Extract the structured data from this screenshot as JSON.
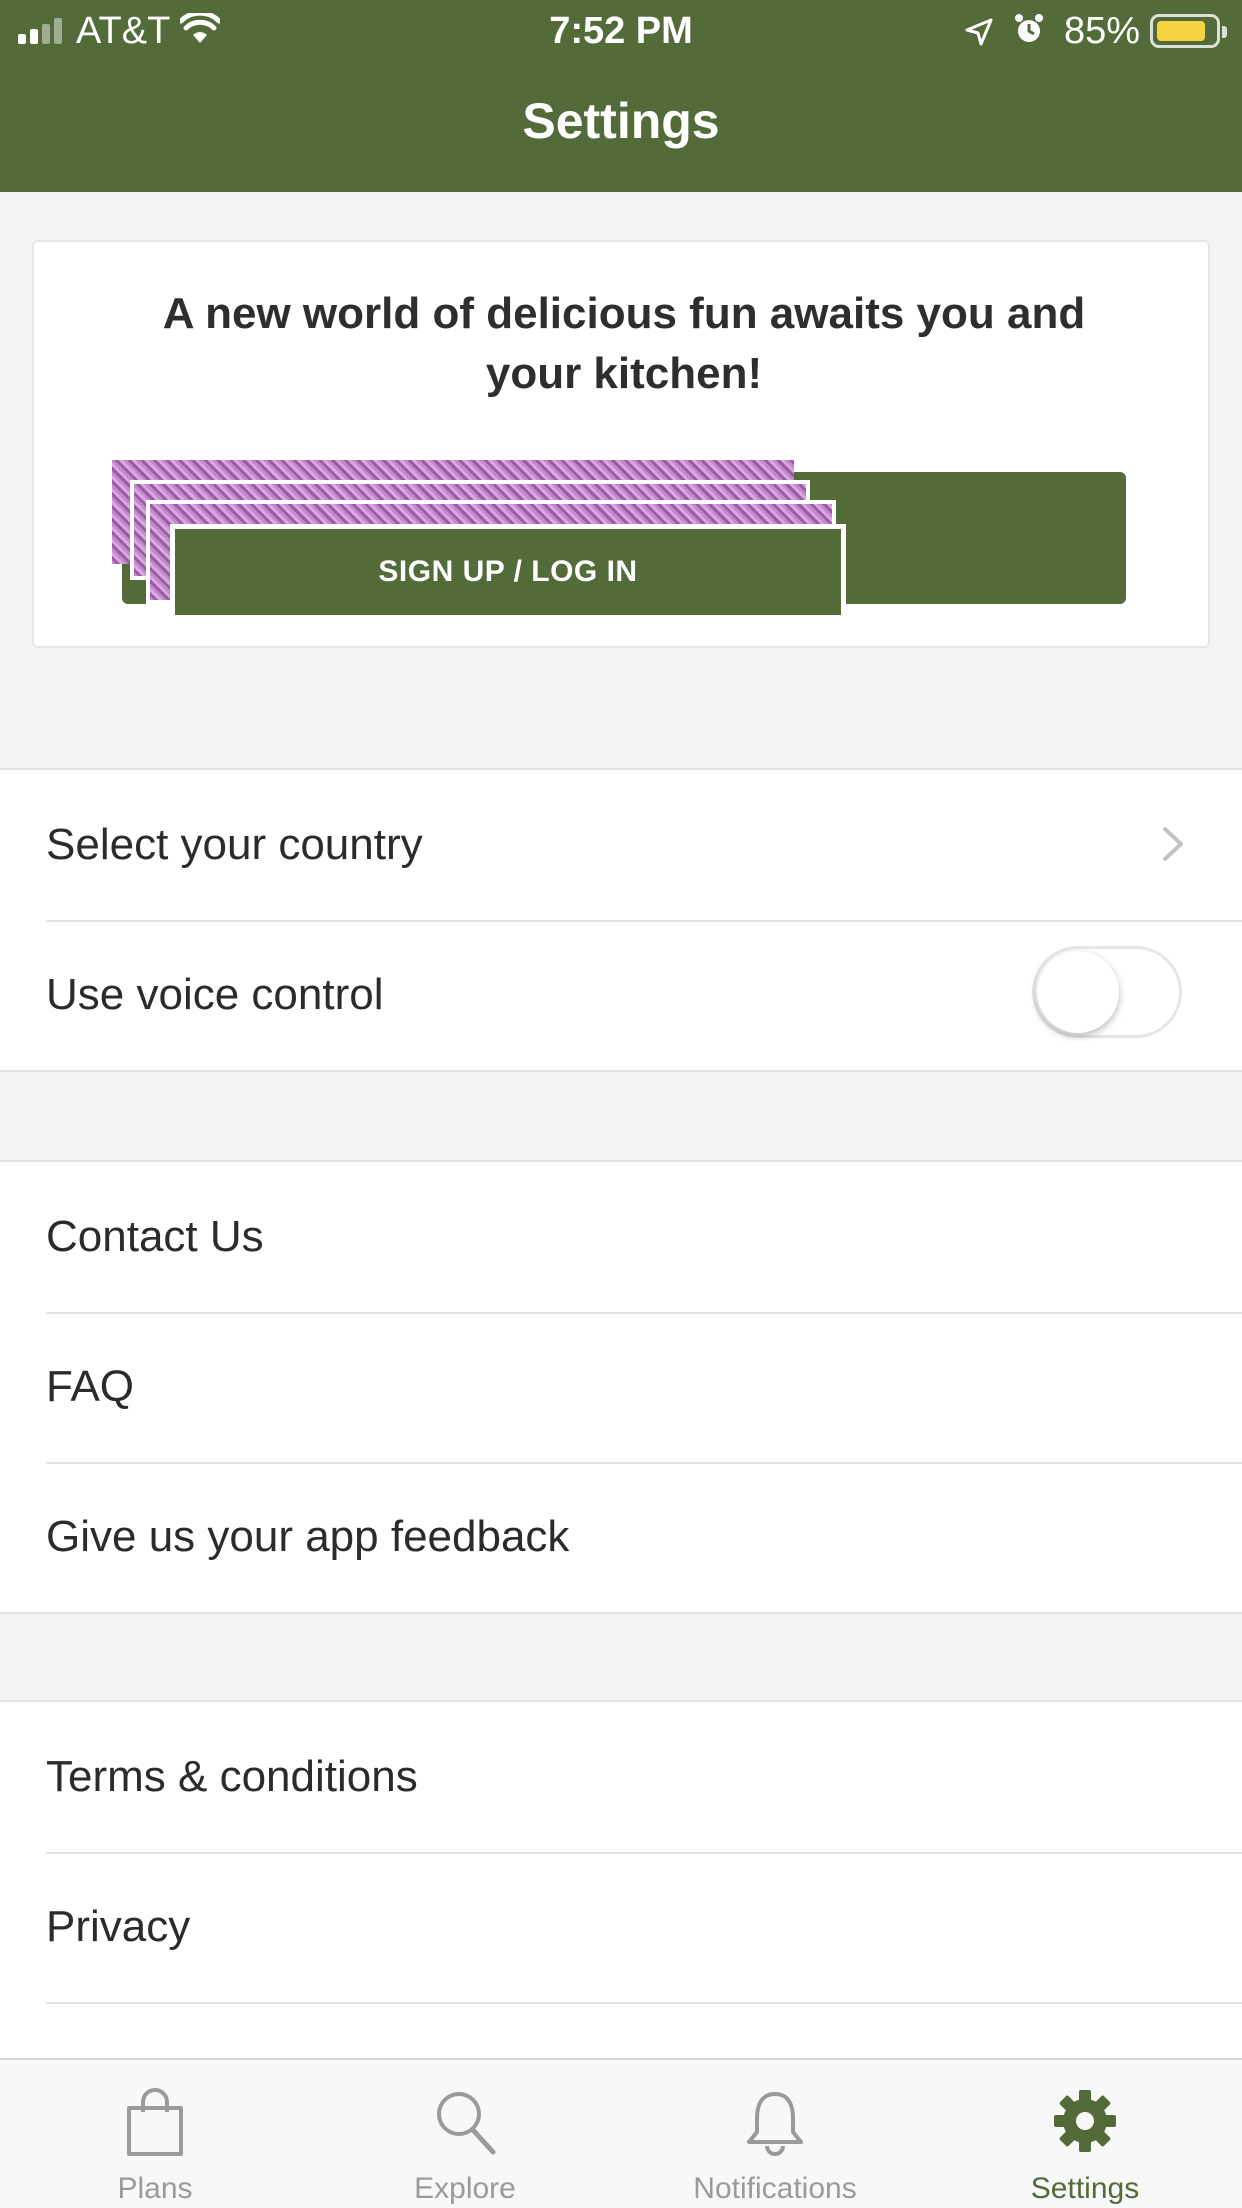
{
  "status_bar": {
    "carrier": "AT&T",
    "time": "7:52 PM",
    "battery_percent": "85%",
    "battery_level": 0.85
  },
  "header": {
    "title": "Settings"
  },
  "promo": {
    "headline": "A new world of delicious fun awaits you and your kitchen!",
    "button_label": "SIGN UP / LOG IN"
  },
  "group1": {
    "select_country": "Select your country",
    "voice_control": "Use voice control",
    "voice_control_on": false
  },
  "group2": {
    "items": [
      "Contact Us",
      "FAQ",
      "Give us your app feedback"
    ]
  },
  "group3": {
    "items": [
      "Terms & conditions",
      "Privacy"
    ]
  },
  "tabbar": {
    "tabs": [
      {
        "label": "Plans",
        "icon": "shopping-bag-icon"
      },
      {
        "label": "Explore",
        "icon": "search-icon"
      },
      {
        "label": "Notifications",
        "icon": "bell-icon"
      },
      {
        "label": "Settings",
        "icon": "gear-icon"
      }
    ],
    "active_tab": "Settings"
  },
  "colors": {
    "brand_green": "#526b38",
    "background": "#f3f3f3",
    "battery_yellow": "#f5d342"
  }
}
